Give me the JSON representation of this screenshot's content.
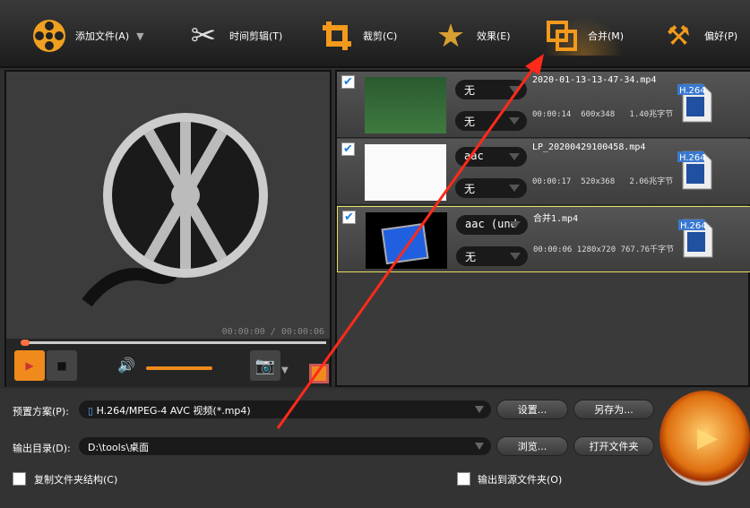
{
  "toolbar": {
    "items": [
      {
        "label": "添加文件(A)",
        "icon": "film-reel-icon"
      },
      {
        "label": "时间剪辑(T)",
        "icon": "scissors-icon"
      },
      {
        "label": "裁剪(C)",
        "icon": "crop-icon"
      },
      {
        "label": "效果(E)",
        "icon": "star-icon"
      },
      {
        "label": "合并(M)",
        "icon": "merge-icon"
      },
      {
        "label": "偏好(P)",
        "icon": "tools-icon"
      }
    ]
  },
  "player": {
    "time": "00:00:00 / 00:00:06",
    "volume_percent": 100,
    "progress_percent": 0
  },
  "files": [
    {
      "checked": true,
      "audio": "无",
      "subtitle": "无",
      "name": "2020-01-13-13-47-34.mp4",
      "duration": "00:00:14",
      "resolution": "600x348",
      "size": "1.40兆字节",
      "codec": "H.264"
    },
    {
      "checked": true,
      "audio": "aac",
      "subtitle": "无",
      "name": "LP_20200429100458.mp4",
      "duration": "00:00:17",
      "resolution": "520x368",
      "size": "2.06兆字节",
      "codec": "H.264"
    },
    {
      "checked": true,
      "audio": "aac (und",
      "subtitle": "无",
      "name": "合并1.mp4",
      "duration": "00:00:06",
      "resolution": "1280x720",
      "size": "767.76千字节",
      "codec": "H.264"
    }
  ],
  "bottom": {
    "preset_label": "预置方案(P):",
    "preset_value": "H.264/MPEG-4 AVC 视频(*.mp4)",
    "settings_btn": "设置...",
    "save_as_btn": "另存为...",
    "output_label": "输出目录(D):",
    "output_value": "D:\\tools\\桌面",
    "browse_btn": "浏览...",
    "open_folder_btn": "打开文件夹",
    "copy_structure": "复制文件夹结构(C)",
    "output_to_source": "输出到源文件夹(O)"
  },
  "colors": {
    "accent": "#f08a1c",
    "annotation": "#ff2a1a"
  }
}
